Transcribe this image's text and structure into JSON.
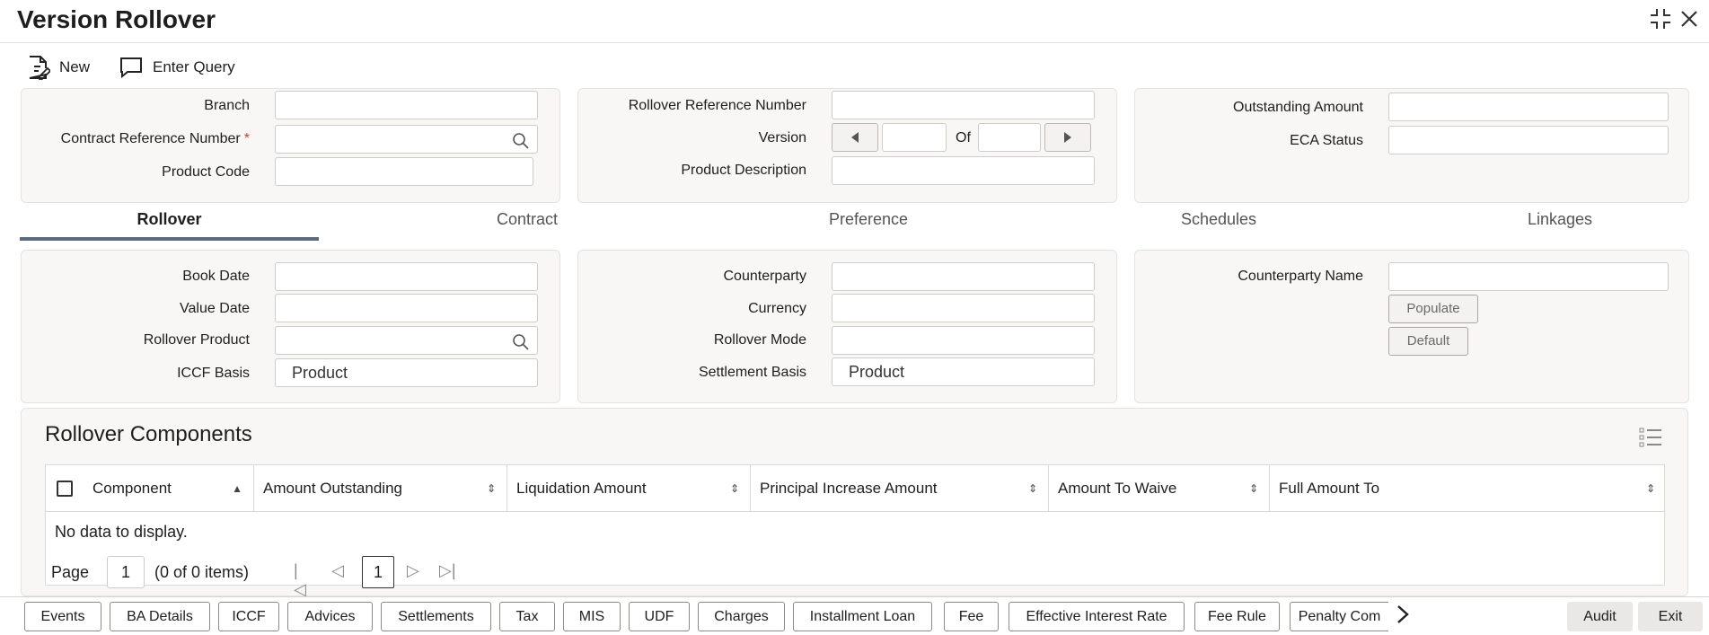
{
  "window": {
    "title": "Version Rollover",
    "collapse_icon": "collapse-icon",
    "close_icon": "close-icon"
  },
  "toolbar": {
    "new_label": "New",
    "enter_query_label": "Enter Query"
  },
  "header": {
    "branch_label": "Branch",
    "contract_ref_label": "Contract Reference Number",
    "required_mark": "*",
    "product_code_label": "Product Code",
    "rollover_ref_label": "Rollover Reference Number",
    "version_label": "Version",
    "of_label": "Of",
    "product_desc_label": "Product Description",
    "outstanding_label": "Outstanding Amount",
    "eca_status_label": "ECA Status"
  },
  "tabs": [
    "Rollover",
    "Contract",
    "Preference",
    "Schedules",
    "Linkages"
  ],
  "rollover": {
    "book_date_label": "Book Date",
    "value_date_label": "Value Date",
    "rollover_product_label": "Rollover Product",
    "iccf_basis_label": "ICCF Basis",
    "iccf_basis_value": "Product",
    "counterparty_label": "Counterparty",
    "currency_label": "Currency",
    "rollover_mode_label": "Rollover Mode",
    "settlement_basis_label": "Settlement Basis",
    "settlement_basis_value": "Product",
    "counterparty_name_label": "Counterparty Name",
    "populate_label": "Populate",
    "default_label": "Default"
  },
  "components": {
    "title": "Rollover Components",
    "columns": [
      "Component",
      "Amount Outstanding",
      "Liquidation Amount",
      "Principal Increase Amount",
      "Amount To Waive",
      "Full Amount To"
    ],
    "empty_text": "No data to display.",
    "page_label": "Page",
    "page_value": "1",
    "items_text": "(0 of 0 items)",
    "current_page": "1"
  },
  "bottom_buttons": [
    "Events",
    "BA Details",
    "ICCF",
    "Advices",
    "Settlements",
    "Tax",
    "MIS",
    "UDF",
    "Charges",
    "Installment Loan",
    "Fee",
    "Effective Interest Rate",
    "Fee Rule",
    "Penalty Com"
  ],
  "footer": {
    "audit_label": "Audit",
    "exit_label": "Exit"
  }
}
